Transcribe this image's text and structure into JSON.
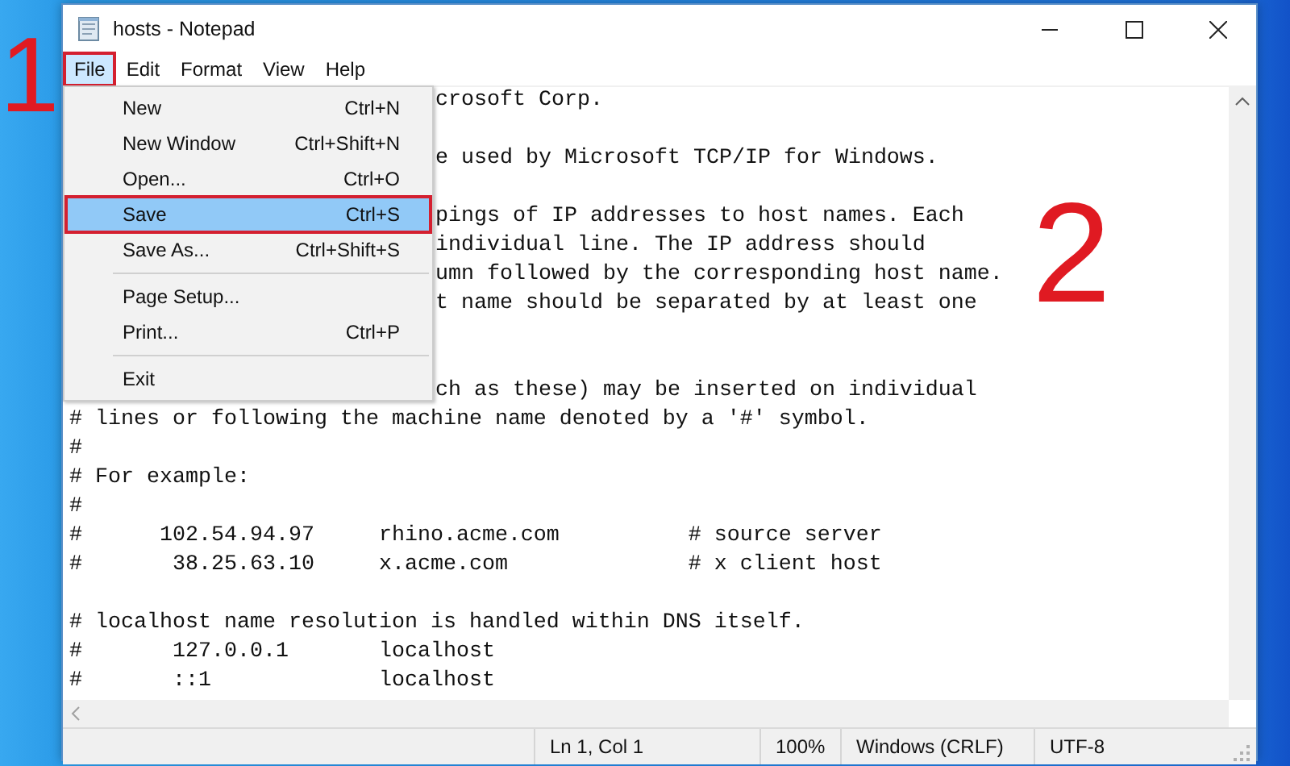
{
  "window": {
    "title": "hosts - Notepad"
  },
  "menu_bar": [
    {
      "label": "File",
      "selected": true,
      "outlined": true
    },
    {
      "label": "Edit",
      "selected": false,
      "outlined": false
    },
    {
      "label": "Format",
      "selected": false,
      "outlined": false
    },
    {
      "label": "View",
      "selected": false,
      "outlined": false
    },
    {
      "label": "Help",
      "selected": false,
      "outlined": false
    }
  ],
  "file_menu": {
    "items": [
      {
        "kind": "item",
        "label": "New",
        "shortcut": "Ctrl+N",
        "selected": false,
        "outlined": false
      },
      {
        "kind": "item",
        "label": "New Window",
        "shortcut": "Ctrl+Shift+N",
        "selected": false,
        "outlined": false
      },
      {
        "kind": "item",
        "label": "Open...",
        "shortcut": "Ctrl+O",
        "selected": false,
        "outlined": false
      },
      {
        "kind": "item",
        "label": "Save",
        "shortcut": "Ctrl+S",
        "selected": true,
        "outlined": true
      },
      {
        "kind": "item",
        "label": "Save As...",
        "shortcut": "Ctrl+Shift+S",
        "selected": false,
        "outlined": false
      },
      {
        "kind": "separator"
      },
      {
        "kind": "item",
        "label": "Page Setup...",
        "selected": false,
        "outlined": false
      },
      {
        "kind": "item",
        "label": "Print...",
        "shortcut": "Ctrl+P",
        "selected": false,
        "outlined": false
      },
      {
        "kind": "separator"
      },
      {
        "kind": "item",
        "label": "Exit",
        "selected": false,
        "outlined": false
      }
    ]
  },
  "editor": {
    "lines": [
      {
        "kind": "partial",
        "text": "crosoft Corp."
      },
      {
        "kind": "blank"
      },
      {
        "kind": "partial",
        "text": "e used by Microsoft TCP/IP for Windows."
      },
      {
        "kind": "blank"
      },
      {
        "kind": "partial",
        "text": "pings of IP addresses to host names. Each"
      },
      {
        "kind": "partial",
        "text": "individual line. The IP address should"
      },
      {
        "kind": "partial",
        "text": "umn followed by the corresponding host name."
      },
      {
        "kind": "partial",
        "text": "t name should be separated by at least one"
      },
      {
        "kind": "blank"
      },
      {
        "kind": "blank"
      },
      {
        "kind": "partial",
        "text": "ch as these) may be inserted on individual"
      },
      {
        "kind": "full",
        "text": "# lines or following the machine name denoted by a '#' symbol."
      },
      {
        "kind": "full",
        "text": "#"
      },
      {
        "kind": "full",
        "text": "# For example:"
      },
      {
        "kind": "full",
        "text": "#"
      },
      {
        "kind": "full",
        "text": "#      102.54.94.97     rhino.acme.com          # source server"
      },
      {
        "kind": "full",
        "text": "#       38.25.63.10     x.acme.com              # x client host"
      },
      {
        "kind": "blank"
      },
      {
        "kind": "full",
        "text": "# localhost name resolution is handled within DNS itself."
      },
      {
        "kind": "full",
        "text": "#       127.0.0.1       localhost"
      },
      {
        "kind": "full",
        "text": "#       ::1             localhost"
      }
    ]
  },
  "status_bar": {
    "cells": [
      "Ln 1, Col 1",
      "100%",
      "Windows (CRLF)",
      "UTF-8"
    ]
  },
  "annotations": [
    {
      "label": "1"
    },
    {
      "label": "2"
    }
  ]
}
